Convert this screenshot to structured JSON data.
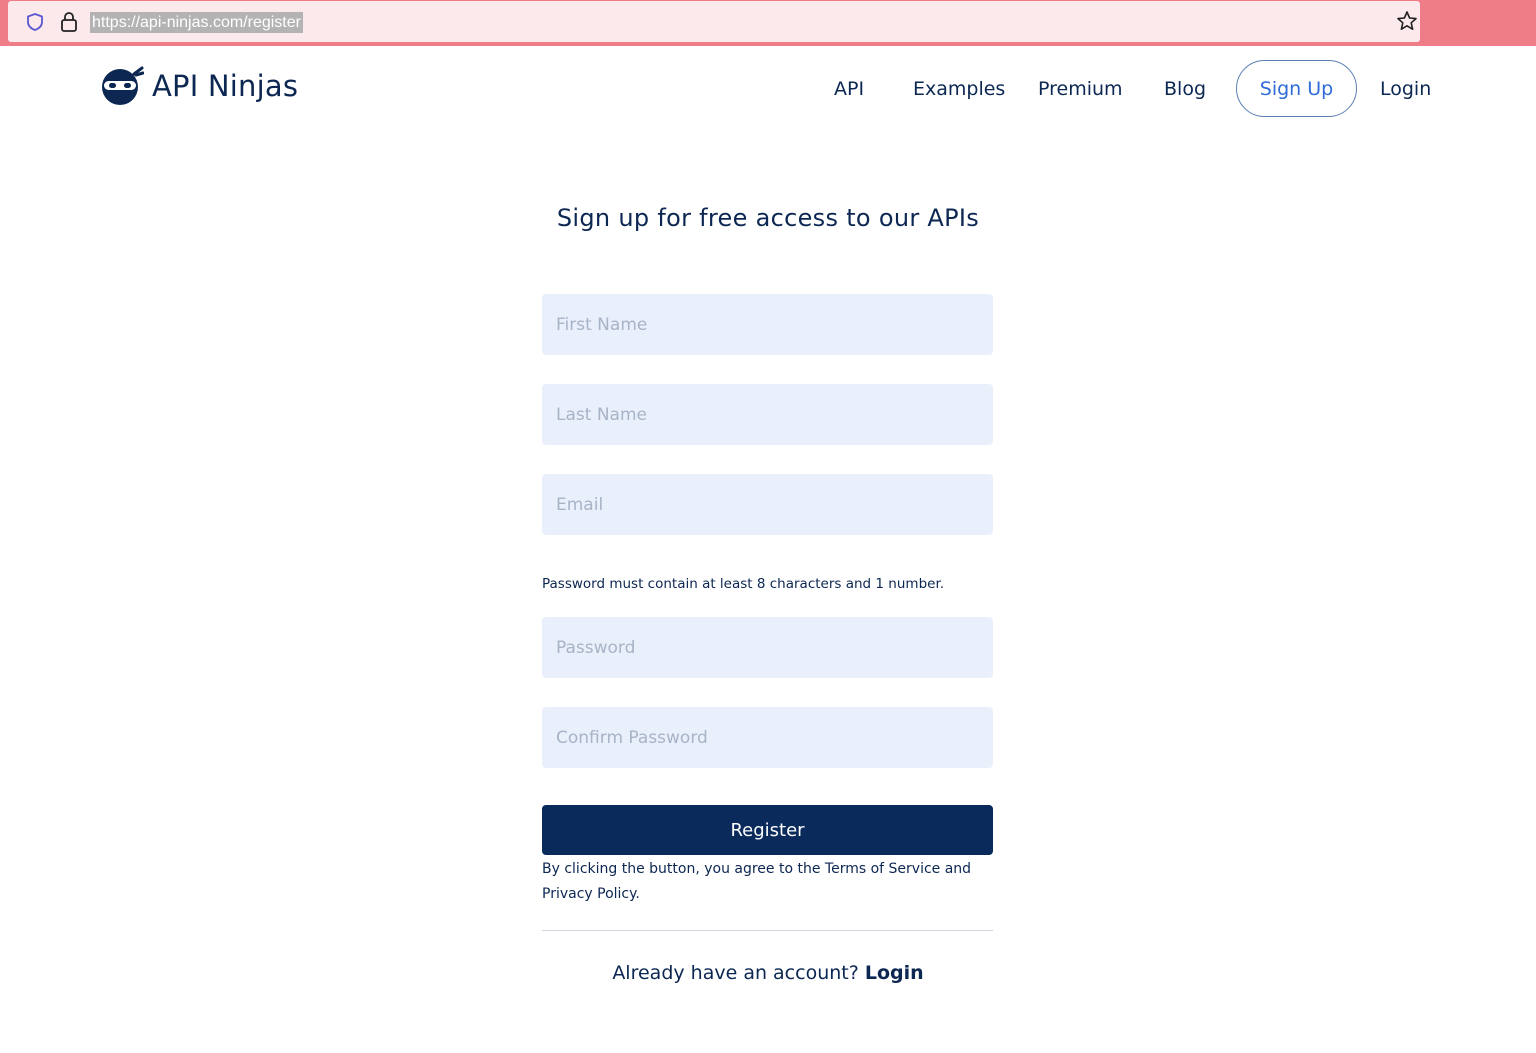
{
  "browser": {
    "url": "https://api-ninjas.com/register",
    "icons": [
      "shield-icon",
      "lock-icon",
      "star-icon"
    ]
  },
  "header": {
    "logo_text": "API Ninjas",
    "nav": {
      "api": "API",
      "examples": "Examples",
      "premium": "Premium",
      "blog": "Blog",
      "signup": "Sign Up",
      "login": "Login"
    }
  },
  "form": {
    "title": "Sign up for free access to our APIs",
    "first_name_placeholder": "First Name",
    "last_name_placeholder": "Last Name",
    "email_placeholder": "Email",
    "password_note": "Password must contain at least 8 characters and 1 number.",
    "password_placeholder": "Password",
    "confirm_password_placeholder": "Confirm Password",
    "register_label": "Register",
    "terms_text": "By clicking the button, you agree to the Terms of Service and Privacy Policy.",
    "already_text": "Already have an account?",
    "login_link": "Login"
  },
  "colors": {
    "brand_navy": "#0a2a5c",
    "signup_blue": "#2f6bd6",
    "input_bg": "#eaf0fb",
    "browser_frame": "#ee7d88"
  }
}
